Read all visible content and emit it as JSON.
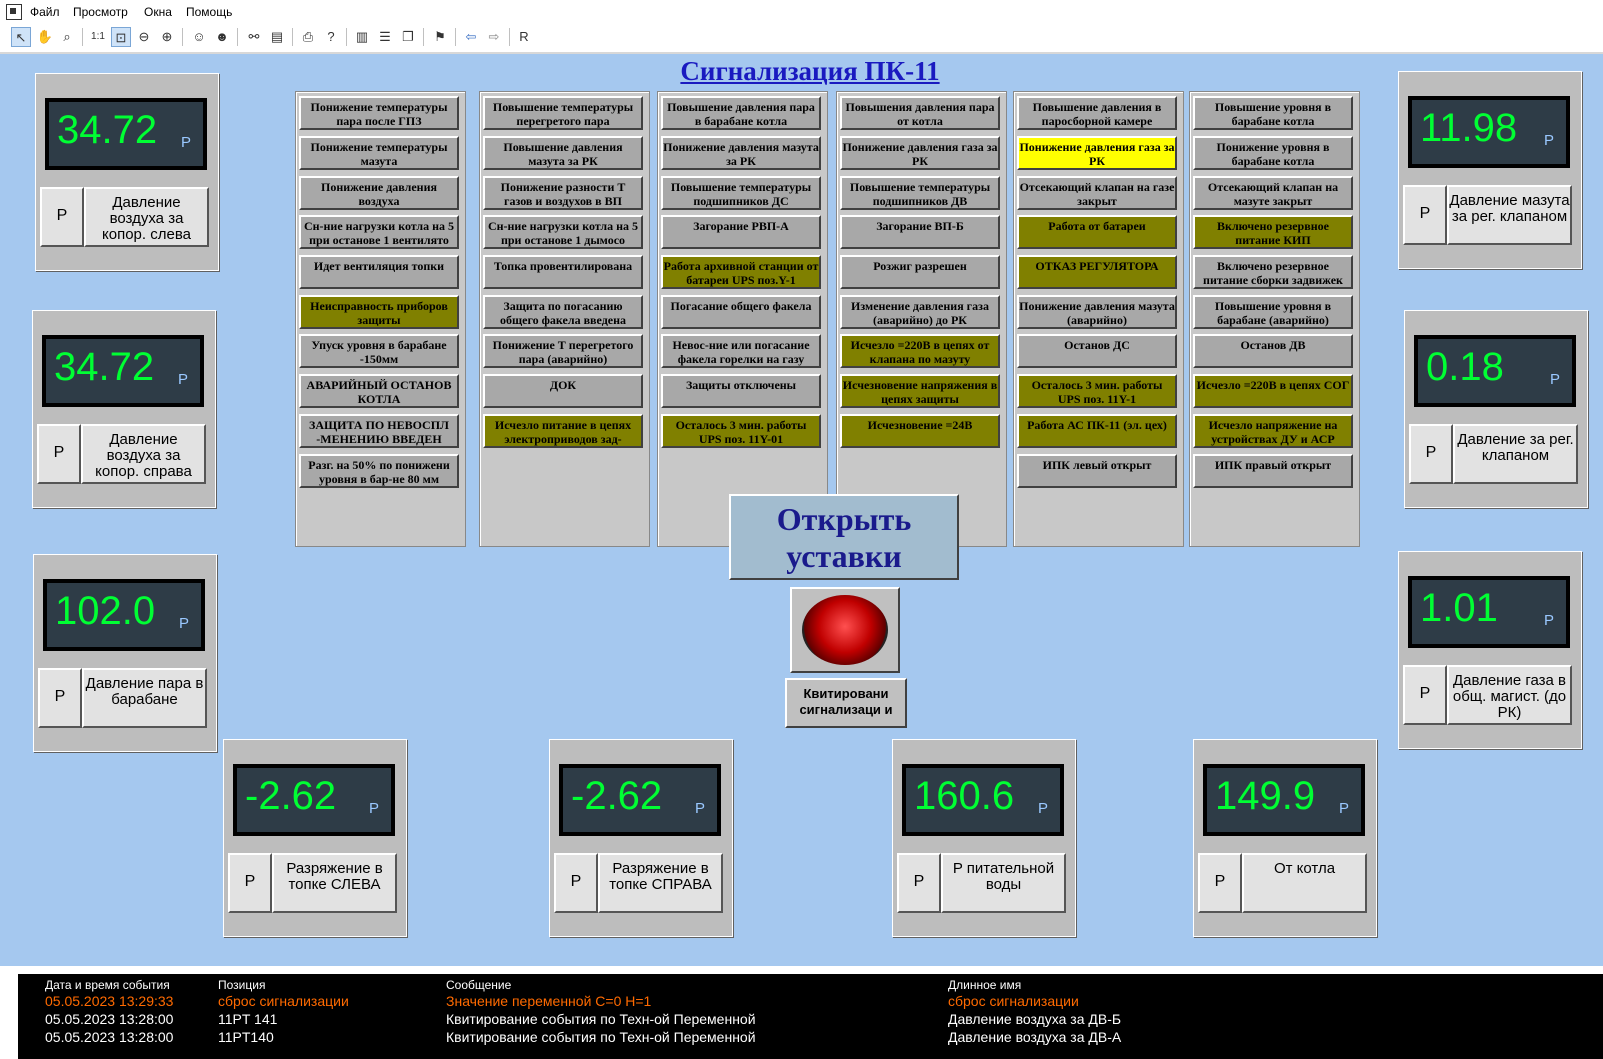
{
  "menu": {
    "items": [
      "Файл",
      "Просмотр",
      "Окна",
      "Помощь"
    ]
  },
  "toolbar": {
    "r_label": "R"
  },
  "page_title": "Сигнализация ПК-11",
  "alarms": [
    [
      {
        "text": "Понижение температуры пара после ГПЗ",
        "state": "grey"
      },
      {
        "text": "Понижение температуры мазута",
        "state": "grey"
      },
      {
        "text": "Понижение давления воздуха",
        "state": "grey"
      },
      {
        "text": "Сн-ние нагрузки котла на 5 при останове 1 вентилято",
        "state": "grey"
      },
      {
        "text": "Идет вентиляция топки",
        "state": "grey"
      },
      {
        "text": "Неисправность приборов защиты",
        "state": "olive"
      },
      {
        "text": "Упуск уровня в барабане -150мм",
        "state": "grey"
      },
      {
        "text": "АВАРИЙНЫЙ ОСТАНОВ КОТЛА",
        "state": "grey"
      },
      {
        "text": "ЗАЩИТА ПО НЕВОСПЛ -МЕНЕНИЮ ВВЕДЕН",
        "state": "grey"
      },
      {
        "text": "Разг. на 50% по понижени уровня в бар-не 80 мм",
        "state": "grey"
      }
    ],
    [
      {
        "text": "Повышение температуры перегретого пара",
        "state": "grey"
      },
      {
        "text": "Повышение давления мазута за РК",
        "state": "grey"
      },
      {
        "text": "Понижение разности Т газов и воздухов в ВП",
        "state": "grey"
      },
      {
        "text": "Сн-ние нагрузки котла на 5 при останове 1 дымосо",
        "state": "grey"
      },
      {
        "text": "Топка провентилирована",
        "state": "grey"
      },
      {
        "text": "Защита по погасанию общего факела введена",
        "state": "grey"
      },
      {
        "text": "Понижение Т перегретого пара (аварийно)",
        "state": "grey"
      },
      {
        "text": "ДОК",
        "state": "grey"
      },
      {
        "text": "Исчезло питание в цепях электроприводов зад-",
        "state": "olive"
      }
    ],
    [
      {
        "text": "Повышение давления пара в барабане котла",
        "state": "grey"
      },
      {
        "text": "Понижение давления мазута за РК",
        "state": "grey"
      },
      {
        "text": "Повышение температуры подшипников ДС",
        "state": "grey"
      },
      {
        "text": "Загорание РВП-А",
        "state": "grey"
      },
      {
        "text": "Работа архивной станции от батареи UPS поз.Y-1",
        "state": "olive"
      },
      {
        "text": "Погасание общего факела",
        "state": "grey"
      },
      {
        "text": "Невос-ние или погасание факела горелки на газу",
        "state": "grey"
      },
      {
        "text": "Защиты отключены",
        "state": "grey"
      },
      {
        "text": "Осталось 3 мин. работы UPS поз. 11Y-01",
        "state": "olive"
      }
    ],
    [
      {
        "text": "Повышения давления пара от котла",
        "state": "grey"
      },
      {
        "text": "Понижение давления газа за РК",
        "state": "grey"
      },
      {
        "text": "Повышение температуры подшипников ДВ",
        "state": "grey"
      },
      {
        "text": "Загорание ВП-Б",
        "state": "grey"
      },
      {
        "text": "Розжиг разрешен",
        "state": "grey"
      },
      {
        "text": "Изменение давления газа (аварийно) до РК",
        "state": "grey"
      },
      {
        "text": "Исчезло =220В в цепях от клапана по мазуту",
        "state": "olive"
      },
      {
        "text": "Исчезновение напряжения в цепях защиты",
        "state": "olive"
      },
      {
        "text": "Исчезновение =24В",
        "state": "olive"
      }
    ],
    [
      {
        "text": "Повышение давления в паросборной камере",
        "state": "grey"
      },
      {
        "text": "Понижение давления газа за РК",
        "state": "yellow"
      },
      {
        "text": "Отсекающий клапан на газе закрыт",
        "state": "grey"
      },
      {
        "text": "Работа от батареи",
        "state": "olive"
      },
      {
        "text": "ОТКАЗ РЕГУЛЯТОРА",
        "state": "olive"
      },
      {
        "text": "Понижение давления мазута (аварийно)",
        "state": "grey"
      },
      {
        "text": "Останов ДС",
        "state": "grey"
      },
      {
        "text": "Осталось 3 мин. работы UPS поз. 11Y-1",
        "state": "olive"
      },
      {
        "text": "Работа АС ПК-11 (эл. цех)",
        "state": "olive"
      },
      {
        "text": "ИПК левый открыт",
        "state": "grey"
      }
    ],
    [
      {
        "text": "Повышение уровня в барабане котла",
        "state": "grey"
      },
      {
        "text": "Понижение уровня в барабане котла",
        "state": "grey"
      },
      {
        "text": "Отсекающий клапан на мазуте закрыт",
        "state": "grey"
      },
      {
        "text": "Включено резервное питание КИП",
        "state": "olive"
      },
      {
        "text": "Включено резервное питание сборки задвижек",
        "state": "grey"
      },
      {
        "text": "Повышение уровня в барабане (аварийно)",
        "state": "grey"
      },
      {
        "text": "Останов ДВ",
        "state": "grey"
      },
      {
        "text": "Исчезло =220В в цепях СОГ",
        "state": "olive"
      },
      {
        "text": "Исчезло напряжение на устройствах ДУ и АСР",
        "state": "olive"
      },
      {
        "text": "ИПК правый открыт",
        "state": "grey"
      }
    ]
  ],
  "alarm_colors": {
    "grey": "#a8a8a8",
    "olive": "#808000",
    "yellow": "#ffff00"
  },
  "gauges": {
    "g1": {
      "value": "34.72",
      "unit": "P",
      "p": "P",
      "label": "Давление воздуха за копор. слева"
    },
    "g2": {
      "value": "34.72",
      "unit": "P",
      "p": "P",
      "label": "Давление воздуха за копор. справа"
    },
    "g3": {
      "value": "102.0",
      "unit": "P",
      "p": "P",
      "label": "Давление пара в барабане"
    },
    "g4": {
      "value": "11.98",
      "unit": "P",
      "p": "P",
      "label": "Давление мазута за рег. клапаном"
    },
    "g5": {
      "value": "0.18",
      "unit": "P",
      "p": "P",
      "label": "Давление за рег. клапаном"
    },
    "g6": {
      "value": "1.01",
      "unit": "P",
      "p": "P",
      "label": "Давление газа в общ. магист. (до РК)"
    },
    "g7": {
      "value": "-2.62",
      "unit": "P",
      "p": "P",
      "label": "Разряжение в топке СЛЕВА"
    },
    "g8": {
      "value": "-2.62",
      "unit": "P",
      "p": "P",
      "label": "Разряжение в топке СПРАВА"
    },
    "g9": {
      "value": "160.6",
      "unit": "P",
      "p": "P",
      "label": "P питательной воды"
    },
    "g10": {
      "value": "149.9",
      "unit": "P",
      "p": "P",
      "label": "От котла"
    }
  },
  "open_setpoints_label": "Открыть уставки",
  "ack_label": "Квитировани сигнализаци и",
  "log": {
    "headers": [
      "Дата и время события",
      "Позиция",
      "Сообщение",
      "Длинное имя"
    ],
    "rows": [
      {
        "date": "05.05.2023 13:29:33",
        "pos": "сброс сигнализации",
        "msg": "Значение переменной С=0  H=1",
        "name": "сброс сигнализации",
        "highlight": true
      },
      {
        "date": "05.05.2023 13:28:00",
        "pos": "11PT 141",
        "msg": "Квитирование события по Техн-ой Переменной",
        "name": "Давление воздуха за ДВ-Б",
        "highlight": false
      },
      {
        "date": "05.05.2023 13:28:00",
        "pos": "11PT140",
        "msg": "Квитирование события по Техн-ой Переменной",
        "name": "Давление воздуха за ДВ-А",
        "highlight": false
      }
    ]
  }
}
